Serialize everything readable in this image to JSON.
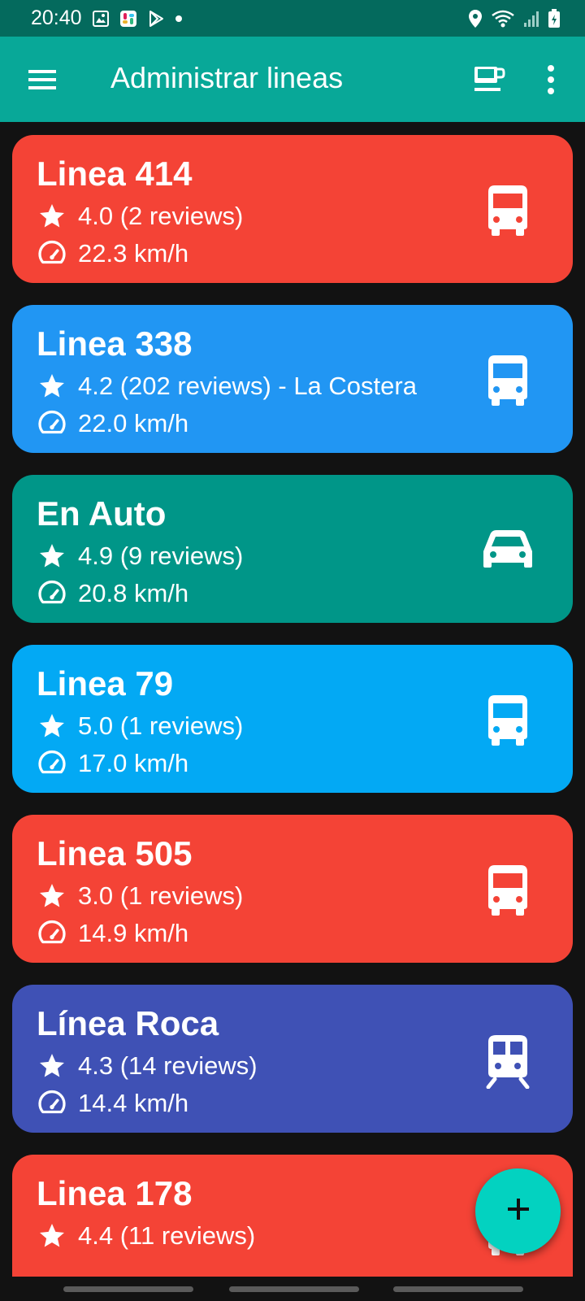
{
  "status_bar": {
    "time": "20:40",
    "left_icons": [
      "gallery-icon",
      "slack-icon",
      "play-store-icon",
      "dot-icon"
    ],
    "right_icons": [
      "location-icon",
      "wifi-icon",
      "signal-icon",
      "battery-icon"
    ]
  },
  "app_bar": {
    "title": "Administrar lineas",
    "left_icon": "menu-icon",
    "right_icons": [
      "coffee-icon",
      "more-vert-icon"
    ]
  },
  "colors": {
    "status_bar": "#046a5d",
    "app_bar": "#08a898",
    "background": "#121212",
    "fab": "#03d2c0"
  },
  "lines": [
    {
      "name": "Linea 414",
      "rating": "4.0 (2 reviews)",
      "speed": "22.3 km/h",
      "color": "#f44336",
      "icon": "bus-icon"
    },
    {
      "name": "Linea 338",
      "rating": "4.2 (202 reviews) - La Costera",
      "speed": "22.0 km/h",
      "color": "#2196f3",
      "icon": "bus-icon"
    },
    {
      "name": "En Auto",
      "rating": "4.9 (9 reviews)",
      "speed": "20.8 km/h",
      "color": "#009688",
      "icon": "car-icon"
    },
    {
      "name": "Linea 79",
      "rating": "5.0 (1 reviews)",
      "speed": "17.0 km/h",
      "color": "#03a9f4",
      "icon": "bus-icon"
    },
    {
      "name": "Linea 505",
      "rating": "3.0 (1 reviews)",
      "speed": "14.9 km/h",
      "color": "#f44336",
      "icon": "bus-icon"
    },
    {
      "name": "Línea Roca",
      "rating": "4.3 (14 reviews)",
      "speed": "14.4 km/h",
      "color": "#3f51b5",
      "icon": "train-icon"
    },
    {
      "name": "Linea 178",
      "rating": "4.4 (11 reviews)",
      "speed": "",
      "color": "#f44336",
      "icon": "bus-icon"
    }
  ],
  "fab": {
    "icon": "plus-icon"
  }
}
